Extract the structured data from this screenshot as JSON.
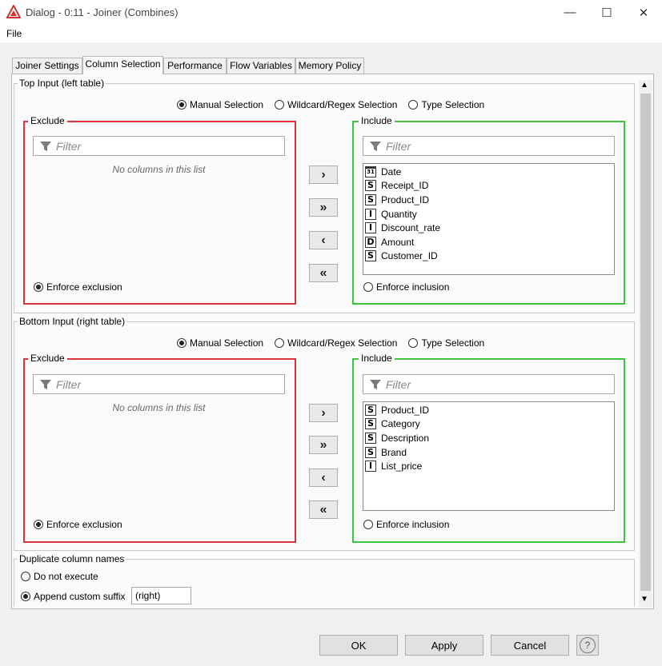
{
  "window": {
    "title": "Dialog - 0:11 - Joiner (Combines)",
    "minimize_glyph": "—",
    "maximize_glyph": "☐",
    "close_glyph": "✕"
  },
  "menu": {
    "file": "File"
  },
  "tabs": [
    "Joiner Settings",
    "Column Selection",
    "Performance",
    "Flow Variables",
    "Memory Policy"
  ],
  "active_tab": "Column Selection",
  "top_input": {
    "title": "Top Input (left table)",
    "modes": [
      "Manual Selection",
      "Wildcard/Regex Selection",
      "Type Selection"
    ],
    "selected_mode": "Manual Selection",
    "exclude": {
      "title": "Exclude",
      "filter_placeholder": "Filter",
      "empty_message": "No columns in this list",
      "enforce_label": "Enforce exclusion",
      "enforce_checked": true
    },
    "include": {
      "title": "Include",
      "filter_placeholder": "Filter",
      "columns": [
        {
          "type": "31",
          "type_icon": "calendar-icon",
          "name": "Date"
        },
        {
          "type": "S",
          "type_icon": "string-type-icon",
          "name": "Receipt_ID"
        },
        {
          "type": "S",
          "type_icon": "string-type-icon",
          "name": "Product_ID"
        },
        {
          "type": "I",
          "type_icon": "integer-type-icon",
          "name": "Quantity"
        },
        {
          "type": "I",
          "type_icon": "integer-type-icon",
          "name": "Discount_rate"
        },
        {
          "type": "D",
          "type_icon": "double-type-icon",
          "name": "Amount"
        },
        {
          "type": "S",
          "type_icon": "string-type-icon",
          "name": "Customer_ID"
        }
      ],
      "enforce_label": "Enforce inclusion",
      "enforce_checked": false
    }
  },
  "bottom_input": {
    "title": "Bottom Input (right table)",
    "modes": [
      "Manual Selection",
      "Wildcard/Regex Selection",
      "Type Selection"
    ],
    "selected_mode": "Manual Selection",
    "exclude": {
      "title": "Exclude",
      "filter_placeholder": "Filter",
      "empty_message": "No columns in this list",
      "enforce_label": "Enforce exclusion",
      "enforce_checked": true
    },
    "include": {
      "title": "Include",
      "filter_placeholder": "Filter",
      "columns": [
        {
          "type": "S",
          "type_icon": "string-type-icon",
          "name": "Product_ID"
        },
        {
          "type": "S",
          "type_icon": "string-type-icon",
          "name": "Category"
        },
        {
          "type": "S",
          "type_icon": "string-type-icon",
          "name": "Description"
        },
        {
          "type": "S",
          "type_icon": "string-type-icon",
          "name": "Brand"
        },
        {
          "type": "I",
          "type_icon": "integer-type-icon",
          "name": "List_price"
        }
      ],
      "enforce_label": "Enforce inclusion",
      "enforce_checked": false
    }
  },
  "move_buttons": {
    "add": "›",
    "add_all": "»",
    "remove": "‹",
    "remove_all": "«"
  },
  "duplicates": {
    "title": "Duplicate column names",
    "option_do_not_execute": "Do not execute",
    "option_append_suffix": "Append custom suffix",
    "selected": "append",
    "suffix_value": "(right)"
  },
  "footer": {
    "ok": "OK",
    "apply": "Apply",
    "cancel": "Cancel",
    "help": "?"
  },
  "colors": {
    "exclude_border": "#d8363a",
    "include_border": "#3ec53e",
    "knime_icon": "#d0342c"
  }
}
